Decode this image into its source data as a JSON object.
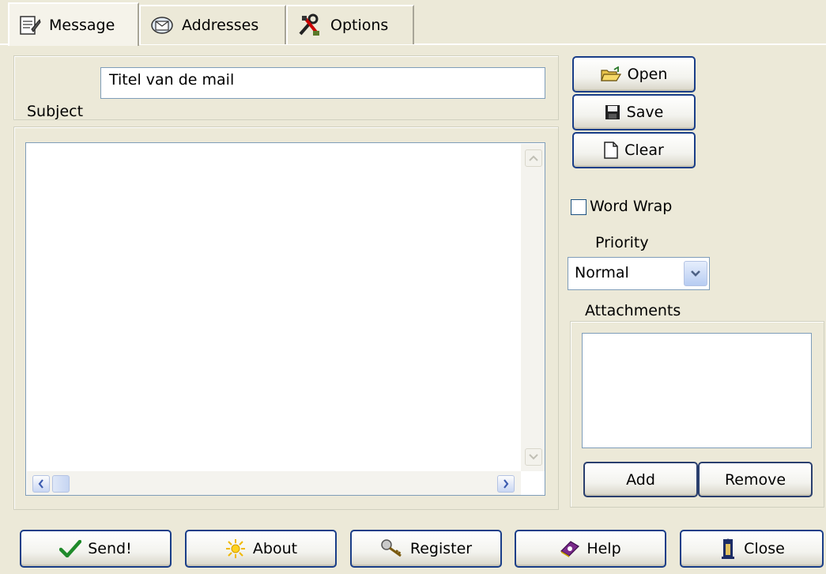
{
  "tabs": [
    {
      "label": "Message",
      "icon": "message-tab-icon"
    },
    {
      "label": "Addresses",
      "icon": "envelope-icon"
    },
    {
      "label": "Options",
      "icon": "tools-icon"
    }
  ],
  "subject": {
    "label": "Subject",
    "value": "Titel van de mail"
  },
  "file_buttons": {
    "open": "Open",
    "save": "Save",
    "clear": "Clear"
  },
  "word_wrap": {
    "label": "Word Wrap",
    "checked": false
  },
  "priority": {
    "label": "Priority",
    "value": "Normal"
  },
  "attachments": {
    "label": "Attachments",
    "add": "Add",
    "remove": "Remove"
  },
  "bottom_buttons": {
    "send": "Send!",
    "about": "About",
    "register": "Register",
    "help": "Help",
    "close": "Close"
  },
  "colors": {
    "face": "#ece9d8",
    "button_border": "#1a3e88",
    "field_border": "#7f9db9",
    "scroll_track": "#f4f3ee"
  }
}
